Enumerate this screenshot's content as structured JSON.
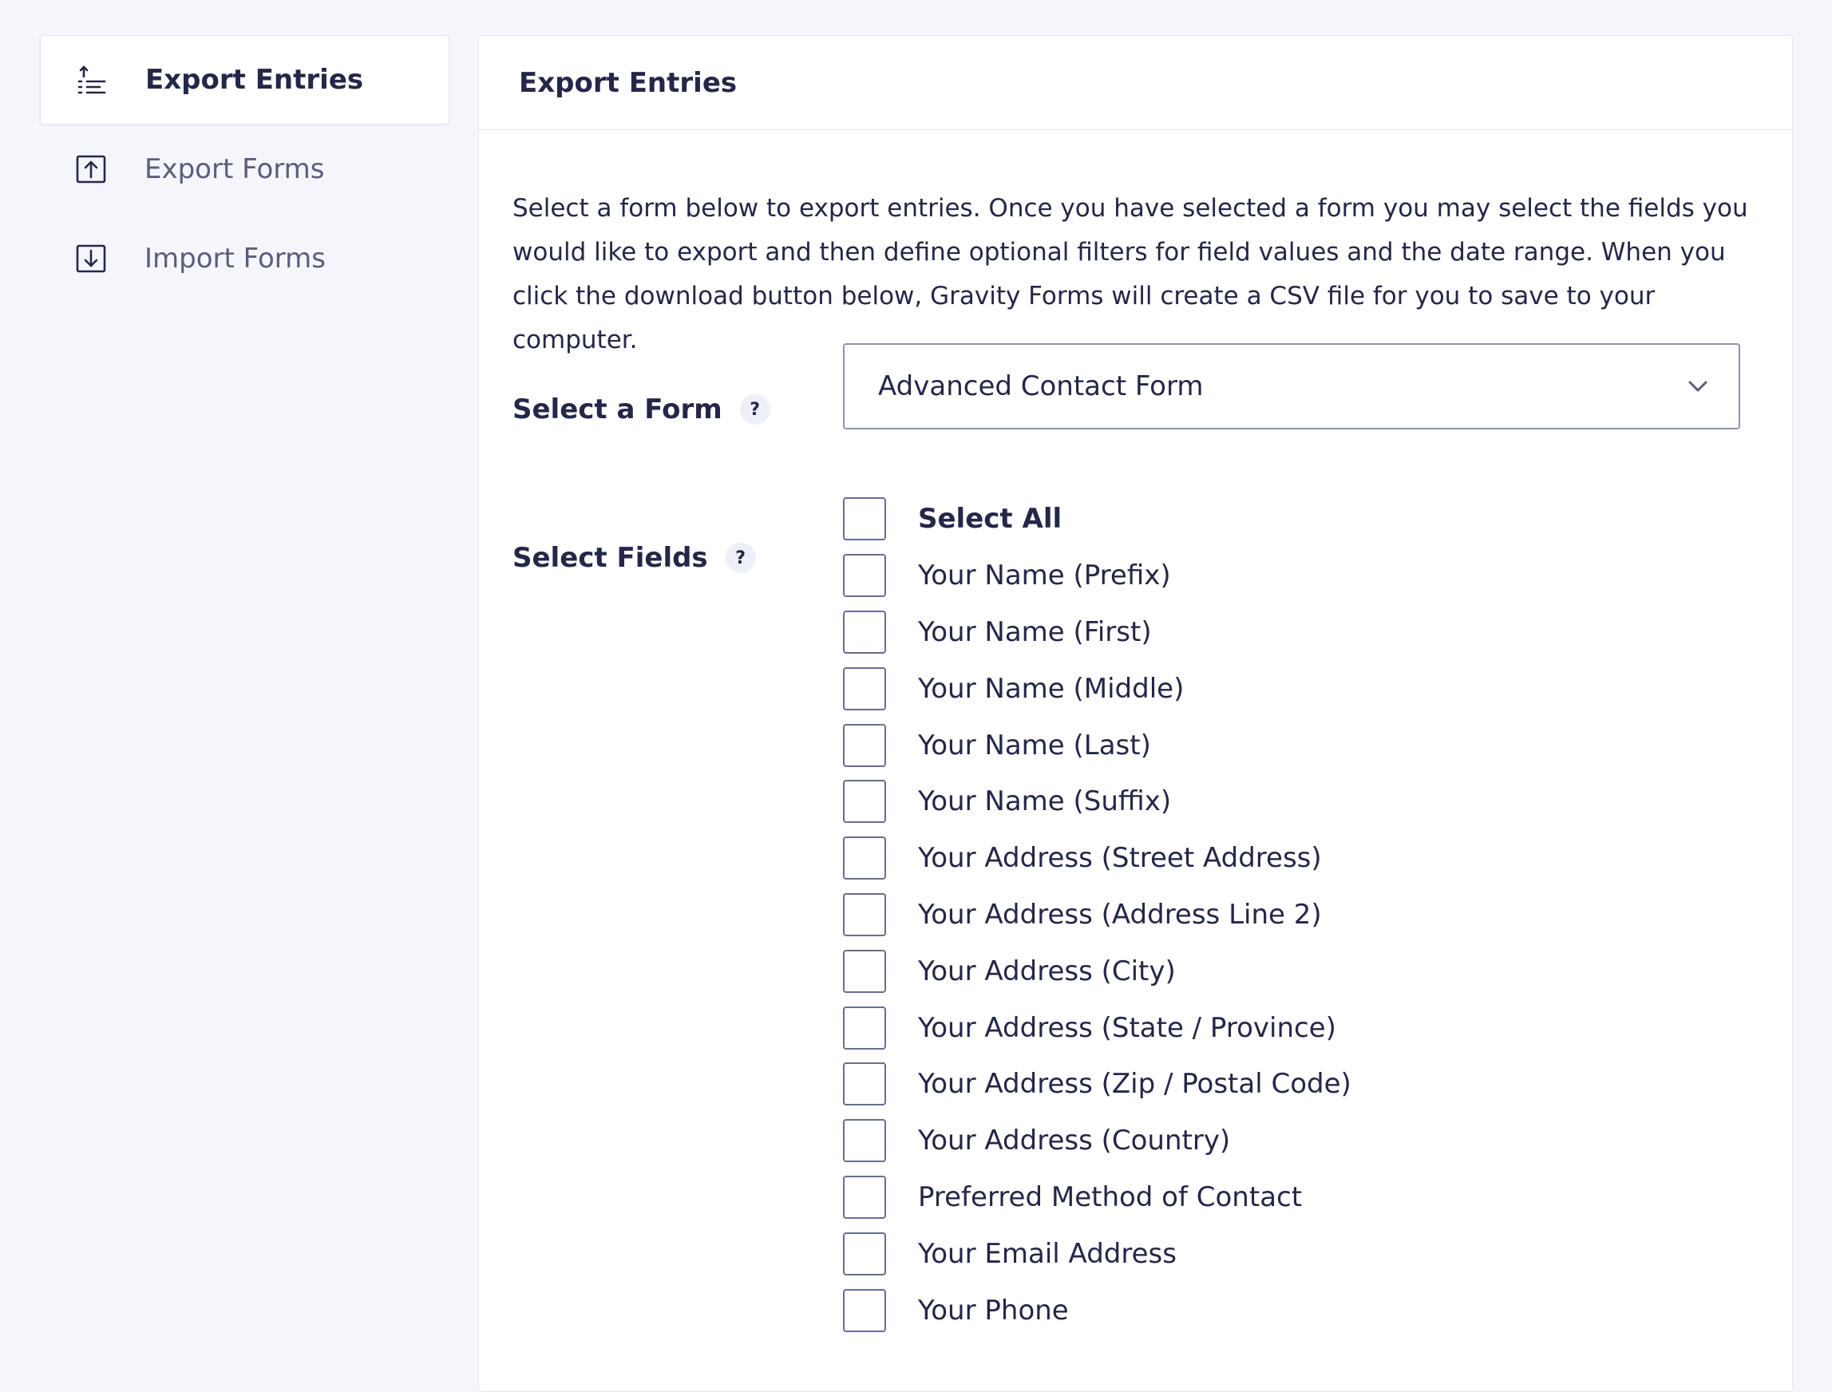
{
  "sidebar": {
    "items": [
      {
        "label": "Export Entries",
        "icon": "export-list-icon",
        "active": true
      },
      {
        "label": "Export Forms",
        "icon": "upload-box-icon",
        "active": false
      },
      {
        "label": "Import Forms",
        "icon": "download-box-icon",
        "active": false
      }
    ]
  },
  "panel": {
    "title": "Export Entries",
    "description": "Select a form below to export entries. Once you have selected a form you may select the fields you would like to export and then define optional filters for field values and the date range. When you click the download button below, Gravity Forms will create a CSV file for you to save to your computer.",
    "select_form": {
      "label": "Select a Form",
      "help": "?",
      "value": "Advanced Contact Form"
    },
    "select_fields": {
      "label": "Select Fields",
      "help": "?",
      "items": [
        "Select All",
        "Your Name (Prefix)",
        "Your Name (First)",
        "Your Name (Middle)",
        "Your Name (Last)",
        "Your Name (Suffix)",
        "Your Address (Street Address)",
        "Your Address (Address Line 2)",
        "Your Address (City)",
        "Your Address (State / Province)",
        "Your Address (Zip / Postal Code)",
        "Your Address (Country)",
        "Preferred Method of Contact",
        "Your Email Address",
        "Your Phone"
      ]
    }
  },
  "colors": {
    "background": "#f4f6fb",
    "text": "#242748",
    "muted_text": "#5b5e7b",
    "border": "#e3e6ef",
    "checkbox_border": "#686e8f"
  }
}
